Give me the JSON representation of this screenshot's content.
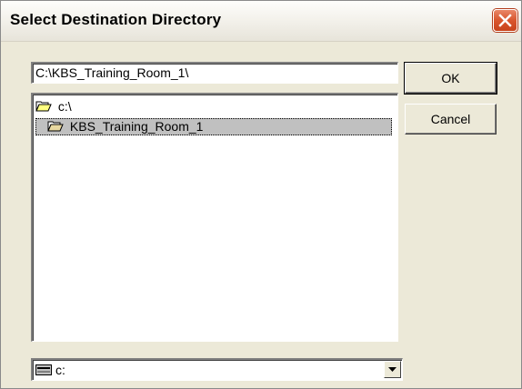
{
  "window": {
    "title": "Select Destination Directory"
  },
  "path_input": {
    "value": "C:\\KBS_Training_Room_1\\"
  },
  "buttons": {
    "ok_label": "OK",
    "cancel_label": "Cancel"
  },
  "tree": {
    "items": [
      {
        "label": "c:\\",
        "icon": "open-folder-icon",
        "selected": false
      },
      {
        "label": "KBS_Training_Room_1",
        "icon": "open-folder-icon",
        "selected": true
      }
    ]
  },
  "drive_select": {
    "value": "c:",
    "icon": "drive-icon"
  },
  "colors": {
    "close_button": "#d9552d",
    "selection": "#c0c0c0",
    "face": "#ece9d8"
  }
}
